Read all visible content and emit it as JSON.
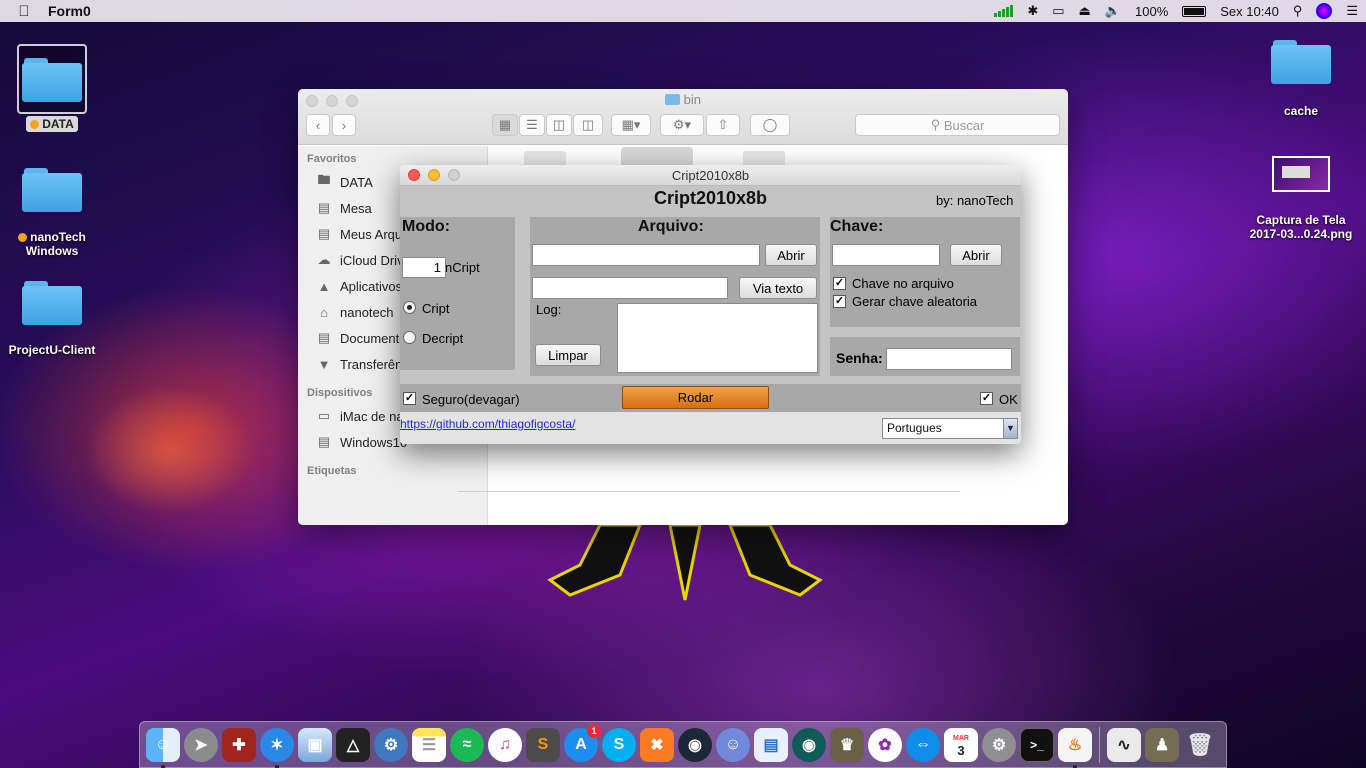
{
  "menubar": {
    "app_name": "Form0",
    "battery": "100%",
    "clock": "Sex 10:40"
  },
  "desktop": {
    "left_icons": [
      {
        "label": "DATA",
        "tag": true
      },
      {
        "label": "nanoTech",
        "label2": "Windows",
        "tag": true
      },
      {
        "label": "ProjectU-Client"
      }
    ],
    "right_icons": [
      {
        "label": "cache"
      },
      {
        "label": "Captura de Tela",
        "label2": "2017-03...0.24.png"
      }
    ]
  },
  "finder": {
    "title": "bin",
    "search_placeholder": "Buscar",
    "favorites_header": "Favoritos",
    "favorites": [
      "DATA",
      "Mesa",
      "Meus Arquivos",
      "iCloud Drive",
      "Aplicativos",
      "nanotech",
      "Documentos",
      "Transferências"
    ],
    "devices_header": "Dispositivos",
    "devices": [
      "iMac de nanoTech",
      "Windows10"
    ],
    "tags_header": "Etiquetas"
  },
  "app": {
    "window_title": "Cript2010x8b",
    "heading": "Cript2010x8b",
    "author": "by: nanoTech",
    "modo": {
      "label": "Modo:",
      "spinner_value": "1",
      "spinner_suffix": "nCript",
      "option_cript": "Cript",
      "option_decript": "Decript",
      "selected": "Cript"
    },
    "arquivo": {
      "label": "Arquivo:",
      "file_input": "",
      "abrir_label": "Abrir",
      "text_input": "",
      "via_texto_label": "Via  texto",
      "log_label": "Log:",
      "log_text": "",
      "limpar_label": "Limpar"
    },
    "chave": {
      "label": "Chave:",
      "key_input": "",
      "abrir_label": "Abrir",
      "chk_arquivo": "Chave no arquivo",
      "chk_aleatoria": "Gerar chave aleatoria",
      "chk_arquivo_checked": true,
      "chk_aleatoria_checked": true
    },
    "senha": {
      "label": "Senha:",
      "value": ""
    },
    "seguro_label": "Seguro(devagar)",
    "seguro_checked": true,
    "rodar_label": "Rodar",
    "ok_label": "OK",
    "ok_checked": true,
    "link": "https://github.com/thiagofigcosta/",
    "language": "Portugues"
  },
  "dock": {
    "calendar_month": "MAR",
    "calendar_day": "3",
    "appstore_badge": "1"
  },
  "colors": {
    "rodar": "#e07a18",
    "panel": "#a8a8a8",
    "folder": "#4aaeea"
  }
}
